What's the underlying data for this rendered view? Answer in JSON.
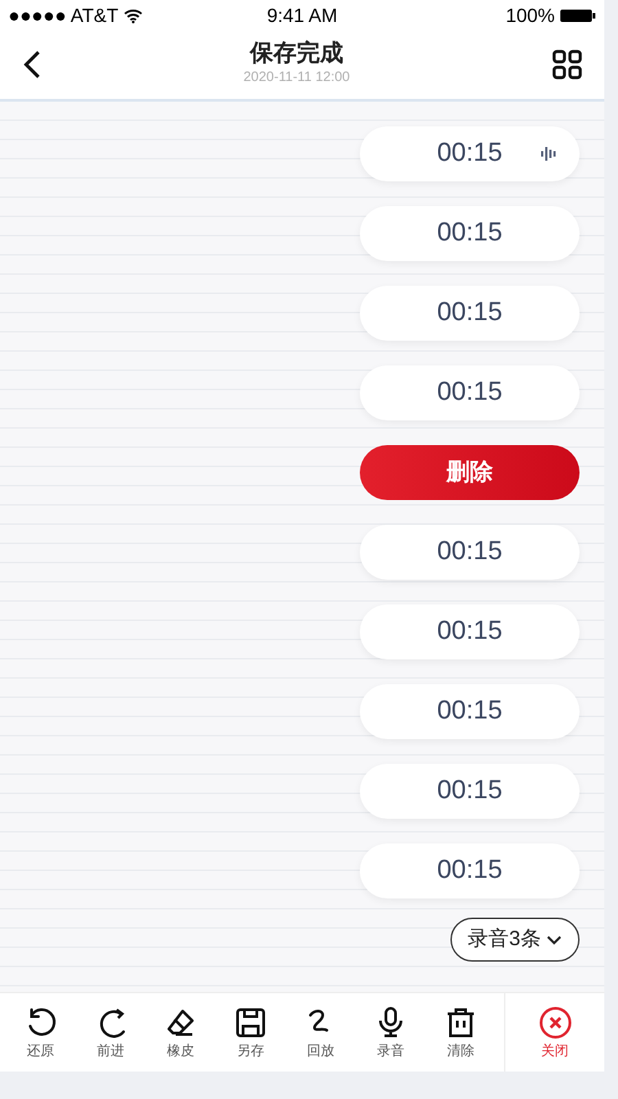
{
  "status_bar": {
    "carrier": "●●●●● AT&T",
    "time": "9:41 AM",
    "battery": "100%"
  },
  "nav": {
    "title": "保存完成",
    "subtitle": "2020-11-11 12:00"
  },
  "recordings": [
    {
      "kind": "clip",
      "duration": "00:15",
      "playing": true
    },
    {
      "kind": "clip",
      "duration": "00:15",
      "playing": false
    },
    {
      "kind": "clip",
      "duration": "00:15",
      "playing": false
    },
    {
      "kind": "clip",
      "duration": "00:15",
      "playing": false
    },
    {
      "kind": "delete",
      "label": "删除"
    },
    {
      "kind": "clip",
      "duration": "00:15",
      "playing": false
    },
    {
      "kind": "clip",
      "duration": "00:15",
      "playing": false
    },
    {
      "kind": "clip",
      "duration": "00:15",
      "playing": false
    },
    {
      "kind": "clip",
      "duration": "00:15",
      "playing": false
    },
    {
      "kind": "clip",
      "duration": "00:15",
      "playing": false
    }
  ],
  "recording_count": {
    "label": "录音3条",
    "expanded": false
  },
  "toolbar": [
    {
      "kind": "tool",
      "label": "还原"
    },
    {
      "kind": "tool",
      "label": "前进"
    },
    {
      "kind": "tool",
      "label": "橡皮"
    },
    {
      "kind": "tool",
      "label": "另存"
    },
    {
      "kind": "tool",
      "label": "回放"
    },
    {
      "kind": "tool",
      "label": "录音"
    },
    {
      "kind": "tool",
      "label": "清除"
    },
    {
      "kind": "close",
      "label": "关闭"
    }
  ]
}
